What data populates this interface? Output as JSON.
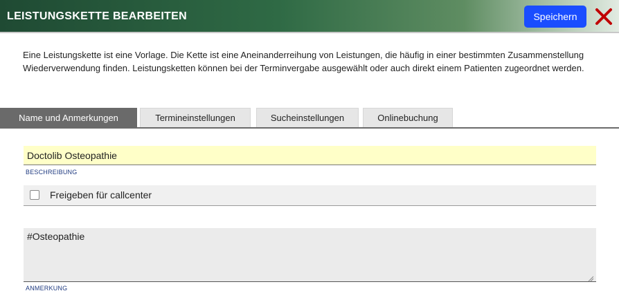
{
  "window": {
    "title": "LEISTUNGSKETTE BEARBEITEN",
    "save_label": "Speichern",
    "close_icon": "close-icon (red X)"
  },
  "intro": {
    "text": "Eine Leistungskette ist eine Vorlage. Die Kette ist eine Aneinanderreihung von Leistungen, die häufig in einer bestimmten Zusammenstellung Wiederverwendung finden. Leistungsketten können bei der Terminvergabe ausgewählt oder auch direkt einem Patienten zugeordnet werden."
  },
  "tabs": [
    {
      "label": "Name und Anmerkungen",
      "active": true
    },
    {
      "label": "Termineinstellungen",
      "active": false
    },
    {
      "label": "Sucheinstellungen",
      "active": false
    },
    {
      "label": "Onlinebuchung",
      "active": false
    }
  ],
  "form": {
    "name_value": "Doctolib Osteopathie",
    "description_caption": "BESCHREIBUNG",
    "callcenter_label": "Freigeben für callcenter",
    "callcenter_checked": false,
    "notes_value": "#Osteopathie",
    "notes_caption": "ANMERKUNG"
  },
  "colors": {
    "save_button": "#1a4dff",
    "close_icon": "#c00000",
    "name_field_bg": "#ffffc8",
    "active_tab": "#6a6a6a",
    "caption_text": "#1f3a80"
  }
}
